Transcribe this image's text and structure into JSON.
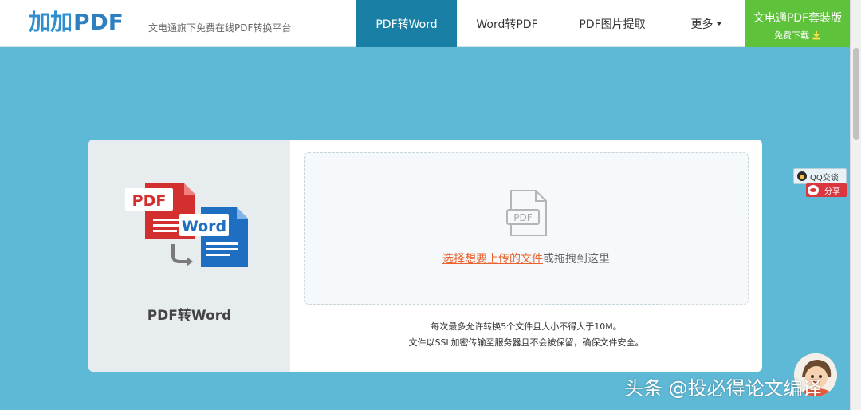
{
  "header": {
    "logo_mark": "加加",
    "logo_suffix": "PDF",
    "tagline": "文电通旗下免费在线PDF转换平台",
    "nav": [
      {
        "label": "PDF转Word",
        "active": true
      },
      {
        "label": "Word转PDF",
        "active": false
      },
      {
        "label": "PDF图片提取",
        "active": false
      },
      {
        "label": "更多",
        "active": false
      }
    ],
    "suite_button": {
      "title": "文电通PDF套装版",
      "subtitle": "免费下载"
    }
  },
  "converter": {
    "title": "PDF转Word",
    "hero_pdf_label": "PDF",
    "hero_word_label": "Word",
    "dropzone_icon_label": "PDF",
    "upload_link": "选择想要上传的文件",
    "upload_rest": "或拖拽到这里",
    "note_1": "每次最多允许转换5个文件且大小不得大于10M。",
    "note_2": "文件以SSL加密传输至服务器且不会被保留，确保文件安全。"
  },
  "side_widgets": {
    "qq": "QQ交谈",
    "share": "分享"
  },
  "watermark": "头条 @投必得论文编译",
  "colors": {
    "page_bg": "#5eb9d6",
    "nav_active": "#1a7fa5",
    "suite_green": "#5fc23b",
    "upload_link": "#e8632e"
  }
}
